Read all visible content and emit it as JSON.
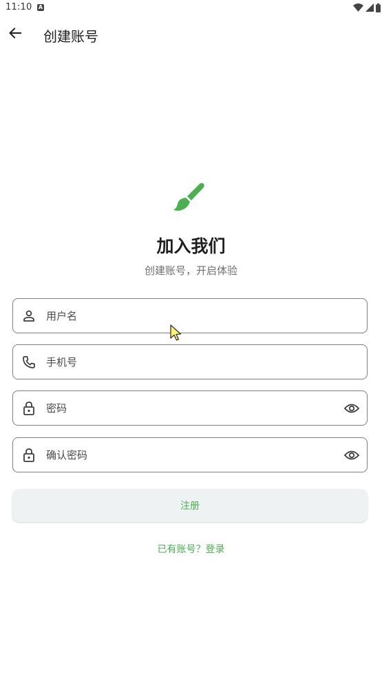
{
  "status_bar": {
    "time": "11:10",
    "notification_icon": "a-badge-icon",
    "wifi_icon": "wifi-icon",
    "signal_icon": "signal-icon",
    "battery_icon": "battery-icon"
  },
  "app_bar": {
    "back_icon": "arrow-left-icon",
    "title": "创建账号"
  },
  "hero": {
    "icon": "paintbrush-icon",
    "title": "加入我们",
    "subtitle": "创建账号，开启体验"
  },
  "form": {
    "username": {
      "placeholder": "用户名",
      "value": "",
      "icon": "person-icon"
    },
    "phone": {
      "placeholder": "手机号",
      "value": "",
      "icon": "phone-icon"
    },
    "password": {
      "placeholder": "密码",
      "value": "",
      "icon": "lock-icon",
      "toggle_icon": "eye-icon"
    },
    "confirm_password": {
      "placeholder": "确认密码",
      "value": "",
      "icon": "lock-icon",
      "toggle_icon": "eye-icon"
    }
  },
  "actions": {
    "register_label": "注册",
    "login_link": "已有账号？登录"
  },
  "colors": {
    "accent": "#4caf50",
    "button_bg": "#eef2f3",
    "field_border": "#7a7f83",
    "subtitle": "#6f6f6f"
  }
}
